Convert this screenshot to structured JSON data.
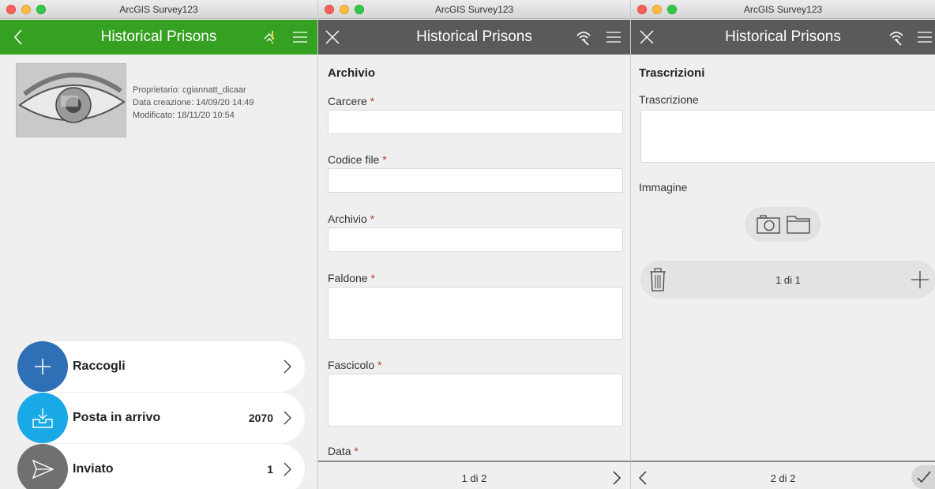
{
  "window_title": "ArcGIS Survey123",
  "app_title": "Historical Prisons",
  "colors": {
    "green_header": "#35a021",
    "gray_header": "#5a5a5a",
    "collect": "#2e6fb5",
    "inbox": "#18a9e6",
    "sent": "#707070",
    "required": "#c0392b"
  },
  "overview": {
    "owner": "Proprietario: cgiannatt_dicaar",
    "created": "Data creazione: 14/09/20 14:49",
    "modified": "Modificato: 18/11/20 10:54",
    "actions": [
      {
        "label": "Raccogli",
        "count": "",
        "icon": "plus-icon"
      },
      {
        "label": "Posta in arrivo",
        "count": "2070",
        "icon": "inbox-icon"
      },
      {
        "label": "Inviato",
        "count": "1",
        "icon": "send-icon"
      }
    ]
  },
  "form_page1": {
    "section": "Archivio",
    "fields": [
      {
        "label": "Carcere",
        "required_mark": "*"
      },
      {
        "label": "Codice file",
        "required_mark": "*"
      },
      {
        "label": "Archivio",
        "required_mark": "*"
      },
      {
        "label": "Faldone",
        "required_mark": "*"
      },
      {
        "label": "Fascicolo",
        "required_mark": "*"
      },
      {
        "label": "Data",
        "required_mark": "*"
      }
    ],
    "page_indicator": "1 di 2"
  },
  "form_page2": {
    "section": "Trascrizioni",
    "transcription_label": "Trascrizione",
    "image_label": "Immagine",
    "repeat_indicator": "1 di 1",
    "page_indicator": "2 di 2"
  }
}
